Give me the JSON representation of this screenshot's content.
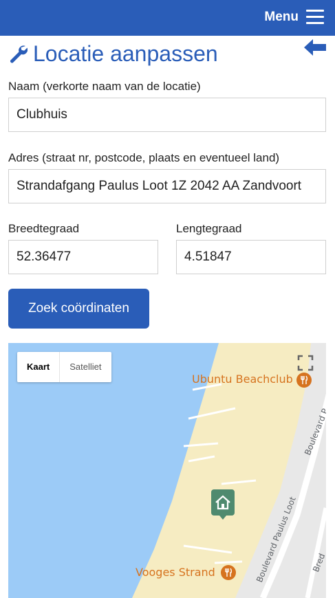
{
  "header": {
    "menu_label": "Menu"
  },
  "page": {
    "title": "Locatie aanpassen"
  },
  "form": {
    "name_label": "Naam (verkorte naam van de locatie)",
    "name_value": "Clubhuis",
    "address_label": "Adres (straat nr, postcode, plaats en eventueel land)",
    "address_value": "Strandafgang Paulus Loot 1Z 2042 AA Zandvoort",
    "lat_label": "Breedtegraad",
    "lat_value": "52.36477",
    "lng_label": "Lengtegraad",
    "lng_value": "4.51847",
    "search_button": "Zoek coördinaten"
  },
  "map": {
    "type_map": "Kaart",
    "type_satellite": "Satelliet",
    "poi_top": "Ubuntu Beachclub",
    "poi_bottom": "Vooges Strand",
    "road_1": "Boulevard Paulus Loot",
    "road_2": "Boulevard P",
    "road_3": "Bred",
    "colors": {
      "water": "#9ccbf7",
      "beach": "#f6ecc2",
      "land": "#e8e8e8",
      "marker": "#4f8a6f",
      "poi": "#d6731f"
    }
  }
}
